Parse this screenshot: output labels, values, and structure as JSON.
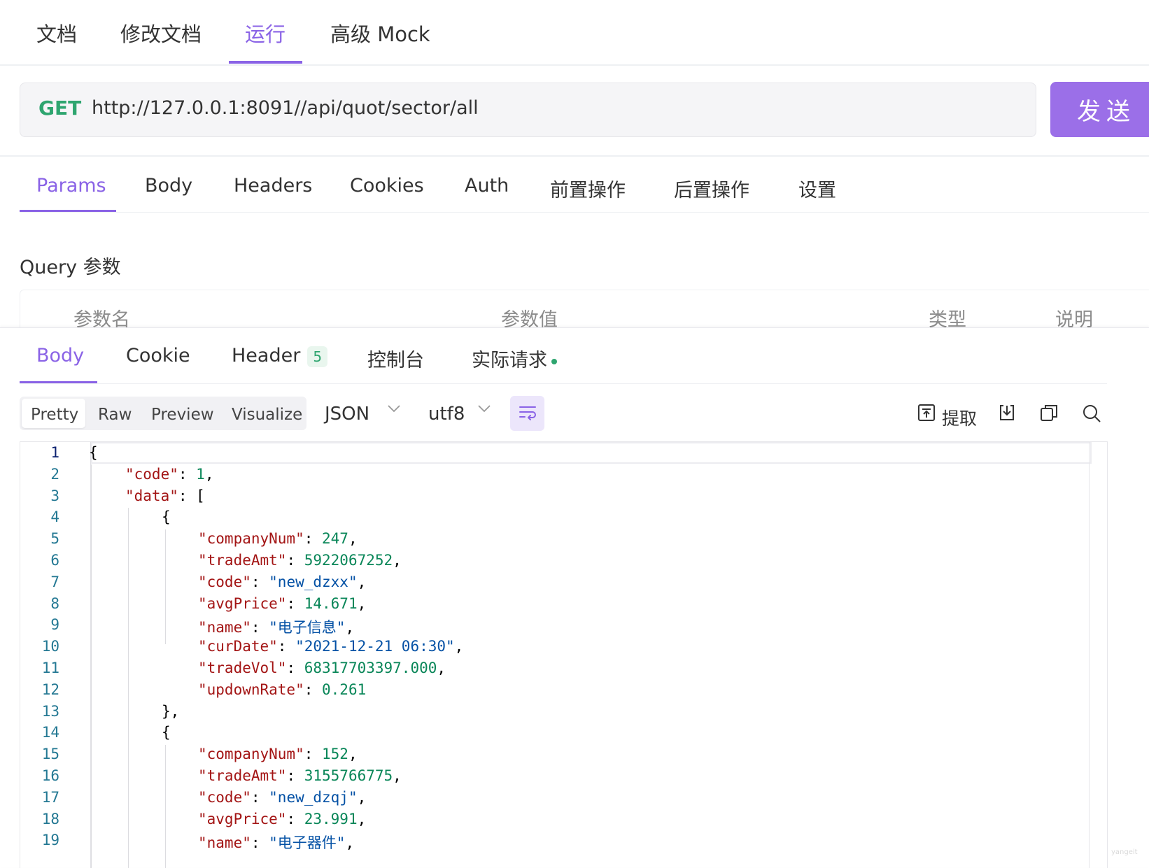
{
  "top_tabs": [
    "文档",
    "修改文档",
    "运行",
    "高级 Mock"
  ],
  "request": {
    "method": "GET",
    "url": "http://127.0.0.1:8091//api/quot/sector/all",
    "send_label": "发送"
  },
  "request_tabs": [
    "Params",
    "Body",
    "Headers",
    "Cookies",
    "Auth",
    "前置操作",
    "后置操作",
    "设置"
  ],
  "query": {
    "title": "Query 参数",
    "columns": [
      "参数名",
      "参数值",
      "类型",
      "说明"
    ]
  },
  "response": {
    "tabs": {
      "body": "Body",
      "cookie": "Cookie",
      "header": "Header",
      "header_count": "5",
      "console": "控制台",
      "actual_request": "实际请求"
    },
    "view_modes": [
      "Pretty",
      "Raw",
      "Preview",
      "Visualize"
    ],
    "format": "JSON",
    "encoding": "utf8",
    "extract_label": "提取",
    "watermark": "yangeit"
  },
  "colors": {
    "accent": "#8a63e6",
    "send_button": "#9b6fe8",
    "method_get": "#2ea56f",
    "json_key": "#a31515",
    "json_number": "#098658",
    "json_string": "#0451a5",
    "line_number": "#237893"
  },
  "icons": {
    "wrap": "wrap-lines-icon",
    "extract": "extract-icon",
    "download": "download-icon",
    "copy": "copy-icon",
    "search": "search-icon",
    "chevron": "chevron-down-icon"
  },
  "code_lines": [
    {
      "n": "1",
      "indent": 0,
      "tokens": [
        [
          "p",
          "{"
        ]
      ]
    },
    {
      "n": "2",
      "indent": 1,
      "tokens": [
        [
          "k",
          "\"code\""
        ],
        [
          "p",
          ": "
        ],
        [
          "n",
          "1"
        ],
        [
          "p",
          ","
        ]
      ]
    },
    {
      "n": "3",
      "indent": 1,
      "tokens": [
        [
          "k",
          "\"data\""
        ],
        [
          "p",
          ": ["
        ]
      ]
    },
    {
      "n": "4",
      "indent": 2,
      "tokens": [
        [
          "p",
          "{"
        ]
      ]
    },
    {
      "n": "5",
      "indent": 3,
      "tokens": [
        [
          "k",
          "\"companyNum\""
        ],
        [
          "p",
          ": "
        ],
        [
          "n",
          "247"
        ],
        [
          "p",
          ","
        ]
      ]
    },
    {
      "n": "6",
      "indent": 3,
      "tokens": [
        [
          "k",
          "\"tradeAmt\""
        ],
        [
          "p",
          ": "
        ],
        [
          "n",
          "5922067252"
        ],
        [
          "p",
          ","
        ]
      ]
    },
    {
      "n": "7",
      "indent": 3,
      "tokens": [
        [
          "k",
          "\"code\""
        ],
        [
          "p",
          ": "
        ],
        [
          "s",
          "\"new_dzxx\""
        ],
        [
          "p",
          ","
        ]
      ]
    },
    {
      "n": "8",
      "indent": 3,
      "tokens": [
        [
          "k",
          "\"avgPrice\""
        ],
        [
          "p",
          ": "
        ],
        [
          "n",
          "14.671"
        ],
        [
          "p",
          ","
        ]
      ]
    },
    {
      "n": "9",
      "indent": 3,
      "tokens": [
        [
          "k",
          "\"name\""
        ],
        [
          "p",
          ": "
        ],
        [
          "s",
          "\"电子信息\""
        ],
        [
          "p",
          ","
        ]
      ]
    },
    {
      "n": "10",
      "indent": 3,
      "tokens": [
        [
          "k",
          "\"curDate\""
        ],
        [
          "p",
          ": "
        ],
        [
          "s",
          "\"2021-12-21 06:30\""
        ],
        [
          "p",
          ","
        ]
      ]
    },
    {
      "n": "11",
      "indent": 3,
      "tokens": [
        [
          "k",
          "\"tradeVol\""
        ],
        [
          "p",
          ": "
        ],
        [
          "n",
          "68317703397.000"
        ],
        [
          "p",
          ","
        ]
      ]
    },
    {
      "n": "12",
      "indent": 3,
      "tokens": [
        [
          "k",
          "\"updownRate\""
        ],
        [
          "p",
          ": "
        ],
        [
          "n",
          "0.261"
        ]
      ]
    },
    {
      "n": "13",
      "indent": 2,
      "tokens": [
        [
          "p",
          "},"
        ]
      ]
    },
    {
      "n": "14",
      "indent": 2,
      "tokens": [
        [
          "p",
          "{"
        ]
      ]
    },
    {
      "n": "15",
      "indent": 3,
      "tokens": [
        [
          "k",
          "\"companyNum\""
        ],
        [
          "p",
          ": "
        ],
        [
          "n",
          "152"
        ],
        [
          "p",
          ","
        ]
      ]
    },
    {
      "n": "16",
      "indent": 3,
      "tokens": [
        [
          "k",
          "\"tradeAmt\""
        ],
        [
          "p",
          ": "
        ],
        [
          "n",
          "3155766775"
        ],
        [
          "p",
          ","
        ]
      ]
    },
    {
      "n": "17",
      "indent": 3,
      "tokens": [
        [
          "k",
          "\"code\""
        ],
        [
          "p",
          ": "
        ],
        [
          "s",
          "\"new_dzqj\""
        ],
        [
          "p",
          ","
        ]
      ]
    },
    {
      "n": "18",
      "indent": 3,
      "tokens": [
        [
          "k",
          "\"avgPrice\""
        ],
        [
          "p",
          ": "
        ],
        [
          "n",
          "23.991"
        ],
        [
          "p",
          ","
        ]
      ]
    },
    {
      "n": "19",
      "indent": 3,
      "tokens": [
        [
          "k",
          "\"name\""
        ],
        [
          "p",
          ": "
        ],
        [
          "s",
          "\"电子器件\""
        ],
        [
          "p",
          ","
        ]
      ]
    }
  ]
}
